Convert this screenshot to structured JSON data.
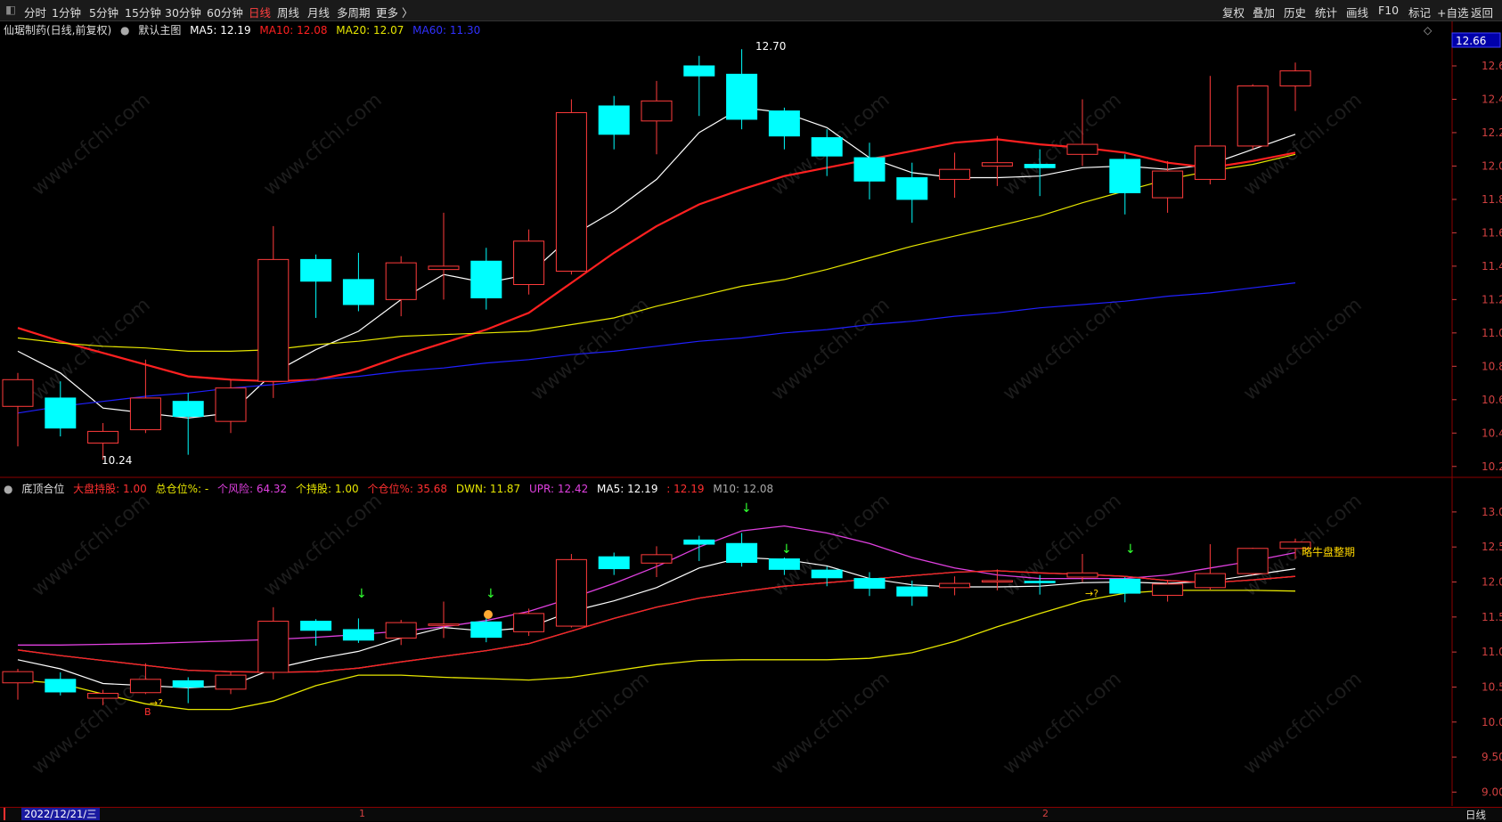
{
  "toolbar": {
    "periods": [
      "分时",
      "1分钟",
      "5分钟",
      "15分钟",
      "30分钟",
      "60分钟",
      "日线",
      "周线",
      "月线",
      "多周期",
      "更多 〉"
    ],
    "active_period": "日线",
    "right_buttons": [
      "复权",
      "叠加",
      "历史",
      "统计",
      "画线",
      "F10",
      "标记",
      "+自选",
      "返回"
    ]
  },
  "main_legend": {
    "stock": "仙琚制药(日线,前复权)",
    "indicator": "默认主图",
    "ma5": "MA5: 12.19",
    "ma10": "MA10: 12.08",
    "ma20": "MA20: 12.07",
    "ma60": "MA60: 11.30"
  },
  "sub_legend": {
    "name": "底顶合位",
    "dapan": "大盘持股: 1.00",
    "zongcang": "总仓位%: -",
    "gefengxian": "个风险: 64.32",
    "gechigu": "个持股: 1.00",
    "gecang": "个仓位%: 35.68",
    "dwn": "DWN: 11.87",
    "upr": "UPR: 12.42",
    "ma5": "MA5: 12.19",
    "extra": ": 12.19",
    "m10": "M10: 12.08"
  },
  "annotations": {
    "high_label": "12.70",
    "low_label": "10.24",
    "current_price": "12.66",
    "sub_text": "略牛盘整期",
    "buy_mark": "B",
    "arrow_text": "→?",
    "down_arrow": "↓",
    "diamond": "◇"
  },
  "bottom": {
    "date": "2022/12/21/三",
    "month1": "1",
    "month2": "2",
    "period": "日线"
  },
  "watermark": "www.cfchi.com",
  "colors": {
    "up": "#ff3b3b",
    "down": "#00ffff",
    "ma5": "#ffffff",
    "ma10": "#ff2020",
    "ma20": "#e6e600",
    "ma60": "#2020ff",
    "upr": "#e040e0",
    "axis": "#d04040"
  },
  "chart_data": [
    {
      "type": "candlestick",
      "title": "仙琚制药(日线,前复权)",
      "y_axis_ticks": [
        12.6,
        12.4,
        12.2,
        12.0,
        11.8,
        11.6,
        11.4,
        11.2,
        11.0,
        10.8,
        10.6,
        10.4,
        10.2
      ],
      "ylim": [
        10.14,
        12.76
      ],
      "candles": [
        {
          "o": 10.56,
          "c": 10.72,
          "h": 10.76,
          "l": 10.32
        },
        {
          "o": 10.61,
          "c": 10.43,
          "h": 10.71,
          "l": 10.38
        },
        {
          "o": 10.34,
          "c": 10.41,
          "h": 10.46,
          "l": 10.24
        },
        {
          "o": 10.42,
          "c": 10.61,
          "h": 10.84,
          "l": 10.4
        },
        {
          "o": 10.59,
          "c": 10.5,
          "h": 10.64,
          "l": 10.27
        },
        {
          "o": 10.47,
          "c": 10.67,
          "h": 10.72,
          "l": 10.4
        },
        {
          "o": 10.71,
          "c": 11.44,
          "h": 11.64,
          "l": 10.61
        },
        {
          "o": 11.44,
          "c": 11.31,
          "h": 11.47,
          "l": 11.09
        },
        {
          "o": 11.32,
          "c": 11.17,
          "h": 11.48,
          "l": 11.13
        },
        {
          "o": 11.2,
          "c": 11.42,
          "h": 11.46,
          "l": 11.1
        },
        {
          "o": 11.38,
          "c": 11.4,
          "h": 11.72,
          "l": 11.2
        },
        {
          "o": 11.43,
          "c": 11.21,
          "h": 11.51,
          "l": 11.14
        },
        {
          "o": 11.29,
          "c": 11.55,
          "h": 11.62,
          "l": 11.23
        },
        {
          "o": 11.37,
          "c": 12.32,
          "h": 12.4,
          "l": 11.35
        },
        {
          "o": 12.36,
          "c": 12.19,
          "h": 12.42,
          "l": 12.1
        },
        {
          "o": 12.27,
          "c": 12.39,
          "h": 12.51,
          "l": 12.07
        },
        {
          "o": 12.6,
          "c": 12.54,
          "h": 12.66,
          "l": 12.3
        },
        {
          "o": 12.55,
          "c": 12.28,
          "h": 12.7,
          "l": 12.22
        },
        {
          "o": 12.33,
          "c": 12.18,
          "h": 12.35,
          "l": 12.1
        },
        {
          "o": 12.17,
          "c": 12.06,
          "h": 12.22,
          "l": 11.94
        },
        {
          "o": 12.05,
          "c": 11.91,
          "h": 12.14,
          "l": 11.8
        },
        {
          "o": 11.93,
          "c": 11.8,
          "h": 12.02,
          "l": 11.66
        },
        {
          "o": 11.92,
          "c": 11.98,
          "h": 12.08,
          "l": 11.81
        },
        {
          "o": 12.0,
          "c": 12.02,
          "h": 12.18,
          "l": 11.88
        },
        {
          "o": 12.01,
          "c": 11.99,
          "h": 12.1,
          "l": 11.82
        },
        {
          "o": 12.07,
          "c": 12.13,
          "h": 12.4,
          "l": 12.0
        },
        {
          "o": 12.04,
          "c": 11.84,
          "h": 12.07,
          "l": 11.71
        },
        {
          "o": 11.81,
          "c": 11.97,
          "h": 12.03,
          "l": 11.72
        },
        {
          "o": 11.92,
          "c": 12.12,
          "h": 12.54,
          "l": 11.89
        },
        {
          "o": 12.12,
          "c": 12.48,
          "h": 12.49,
          "l": 12.1
        },
        {
          "o": 12.48,
          "c": 12.57,
          "h": 12.62,
          "l": 12.33
        }
      ],
      "series": [
        {
          "name": "MA5",
          "values": [
            10.89,
            10.76,
            10.55,
            10.52,
            10.49,
            10.52,
            10.76,
            10.9,
            11.01,
            11.2,
            11.35,
            11.3,
            11.35,
            11.58,
            11.73,
            11.92,
            12.2,
            12.35,
            12.32,
            12.23,
            12.05,
            11.96,
            11.93,
            11.93,
            11.94,
            11.99,
            12.0,
            11.98,
            12.01,
            12.1,
            12.19
          ]
        },
        {
          "name": "MA10",
          "values": [
            11.03,
            10.95,
            10.88,
            10.81,
            10.74,
            10.72,
            10.71,
            10.72,
            10.77,
            10.86,
            10.94,
            11.02,
            11.12,
            11.3,
            11.48,
            11.64,
            11.77,
            11.86,
            11.94,
            11.99,
            12.04,
            12.09,
            12.14,
            12.16,
            12.13,
            12.11,
            12.08,
            12.02,
            11.99,
            12.03,
            12.08
          ]
        },
        {
          "name": "MA20",
          "values": [
            10.97,
            10.94,
            10.92,
            10.91,
            10.89,
            10.89,
            10.9,
            10.93,
            10.95,
            10.98,
            10.99,
            11.0,
            11.01,
            11.05,
            11.09,
            11.16,
            11.22,
            11.28,
            11.32,
            11.38,
            11.45,
            11.52,
            11.58,
            11.64,
            11.7,
            11.78,
            11.85,
            11.92,
            11.97,
            12.01,
            12.07
          ]
        },
        {
          "name": "MA60",
          "values": [
            10.52,
            10.56,
            10.59,
            10.62,
            10.64,
            10.67,
            10.69,
            10.72,
            10.74,
            10.77,
            10.79,
            10.82,
            10.84,
            10.87,
            10.89,
            10.92,
            10.95,
            10.97,
            11.0,
            11.02,
            11.05,
            11.07,
            11.1,
            11.12,
            11.15,
            11.17,
            11.19,
            11.22,
            11.24,
            11.27,
            11.3
          ]
        }
      ]
    },
    {
      "type": "line",
      "title": "底顶合位",
      "y_axis_ticks": [
        13.0,
        12.5,
        12.0,
        11.5,
        11.0,
        10.5,
        10.0,
        9.5,
        9.0
      ],
      "ylim": [
        8.84,
        13.24
      ],
      "series": [
        {
          "name": "UPR",
          "values": [
            11.1,
            11.1,
            11.11,
            11.12,
            11.14,
            11.16,
            11.18,
            11.21,
            11.25,
            11.3,
            11.36,
            11.45,
            11.58,
            11.77,
            11.98,
            12.22,
            12.5,
            12.73,
            12.8,
            12.7,
            12.55,
            12.35,
            12.2,
            12.1,
            12.05,
            12.05,
            12.05,
            12.1,
            12.2,
            12.3,
            12.42
          ]
        },
        {
          "name": "DWN",
          "values": [
            10.6,
            10.55,
            10.4,
            10.26,
            10.18,
            10.18,
            10.3,
            10.52,
            10.67,
            10.67,
            10.64,
            10.62,
            10.6,
            10.64,
            10.73,
            10.82,
            10.88,
            10.89,
            10.89,
            10.89,
            10.91,
            10.99,
            11.15,
            11.36,
            11.55,
            11.73,
            11.84,
            11.88,
            11.88,
            11.88,
            11.87
          ]
        },
        {
          "name": "M10",
          "values": [
            11.03,
            10.95,
            10.88,
            10.81,
            10.74,
            10.72,
            10.71,
            10.72,
            10.77,
            10.86,
            10.94,
            11.02,
            11.12,
            11.3,
            11.48,
            11.64,
            11.77,
            11.86,
            11.94,
            11.99,
            12.04,
            12.09,
            12.14,
            12.16,
            12.13,
            12.11,
            12.08,
            12.02,
            11.99,
            12.03,
            12.08
          ]
        }
      ]
    }
  ]
}
